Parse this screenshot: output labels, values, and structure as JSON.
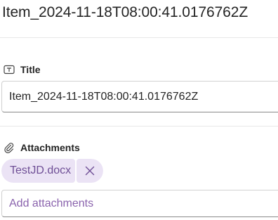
{
  "page": {
    "title": "Item_2024-11-18T08:00:41.0176762Z"
  },
  "fields": {
    "title": {
      "label": "Title",
      "icon": "text-field-icon",
      "value": "Item_2024-11-18T08:00:41.0176762Z"
    },
    "attachments": {
      "label": "Attachments",
      "icon": "paperclip-icon",
      "files": [
        {
          "name": "TestJD.docx"
        }
      ],
      "placeholder": "Add attachments"
    }
  },
  "colors": {
    "chip_background": "#ebe3f5",
    "chip_text": "#6f4f96",
    "placeholder_text": "#8a63ad",
    "divider": "#e8e8e8"
  }
}
